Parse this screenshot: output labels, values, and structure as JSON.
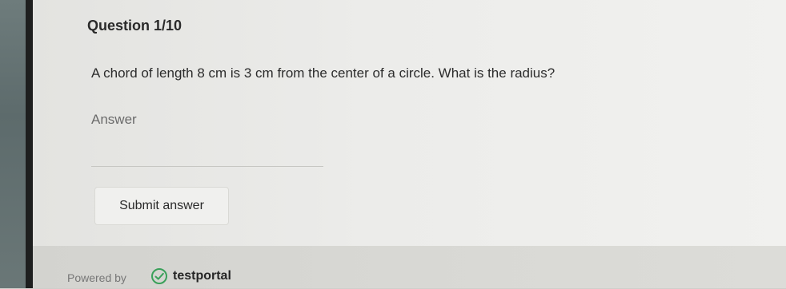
{
  "question": {
    "title": "Question 1/10",
    "text": "A chord of length 8 cm is 3 cm from the center of a circle. What is the radius?"
  },
  "answer": {
    "label": "Answer",
    "value": "",
    "placeholder": ""
  },
  "submit_label": "Submit answer",
  "footer": {
    "powered_by": "Powered by",
    "brand": "testportal",
    "brand_icon": "check-circle-icon",
    "brand_color": "#3aa05a"
  }
}
